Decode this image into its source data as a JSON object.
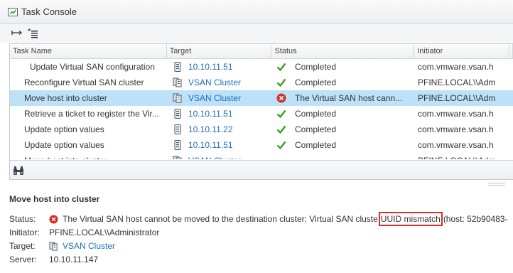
{
  "window": {
    "title": "Task Console"
  },
  "toolbar": {
    "buttons": [
      "collapse-all-icon",
      "expand-list-icon"
    ]
  },
  "grid": {
    "columns": [
      "Task Name",
      "Target",
      "Status",
      "Initiator"
    ],
    "rows": [
      {
        "name": "Update Virtual SAN configuration",
        "target": "10.10.11.51",
        "target_icon": "host-icon",
        "status": "Completed",
        "status_icon": "checkmark-icon",
        "initiator": "com.vmware.vsan.h"
      },
      {
        "name": "Reconfigure Virtual SAN cluster",
        "target": "VSAN Cluster",
        "target_icon": "cluster-icon",
        "status": "Completed",
        "status_icon": "checkmark-icon",
        "initiator": "PFINE.LOCAL\\\\Adm"
      },
      {
        "name": "Move host into cluster",
        "target": "VSAN Cluster",
        "target_icon": "cluster-icon",
        "status": "The Virtual SAN host cann...",
        "status_icon": "error-icon",
        "initiator": "PFINE.LOCAL\\\\Adm"
      },
      {
        "name": "Retrieve a ticket to register the Vir...",
        "target": "10.10.11.51",
        "target_icon": "host-icon",
        "status": "Completed",
        "status_icon": "checkmark-icon",
        "initiator": "com.vmware.vsan.h"
      },
      {
        "name": "Update option values",
        "target": "10.10.11.22",
        "target_icon": "host-icon",
        "status": "Completed",
        "status_icon": "checkmark-icon",
        "initiator": "com.vmware.vsan.h"
      },
      {
        "name": "Update option values",
        "target": "10.10.11.51",
        "target_icon": "host-icon",
        "status": "Completed",
        "status_icon": "checkmark-icon",
        "initiator": "com.vmware.vsan.h"
      },
      {
        "name": "Move host into cluster",
        "target": "VSAN Cluster",
        "target_icon": "cluster-icon",
        "status": "",
        "status_icon": "",
        "initiator": "PFINE.LOCAL\\\\Adm"
      }
    ],
    "selected_row": 2
  },
  "details": {
    "title": "Move host into cluster",
    "status_label": "Status:",
    "status_text_before": "The Virtual SAN host cannot be moved to the destination cluster: Virtual SAN cluste",
    "status_text_highlight": "UUID mismatch",
    "status_text_after": "(host: 52b90483-",
    "initiator_label": "Initiator:",
    "initiator": "PFINE.LOCAL\\\\Administrator",
    "target_label": "Target:",
    "target": "VSAN Cluster",
    "server_label": "Server:",
    "server": "10.10.11.147"
  },
  "colors": {
    "link": "#1e6fb8",
    "selection": "#bde1f8",
    "success": "#3a9a2b",
    "error": "#d9302c",
    "highlight_box": "#d9302c"
  }
}
